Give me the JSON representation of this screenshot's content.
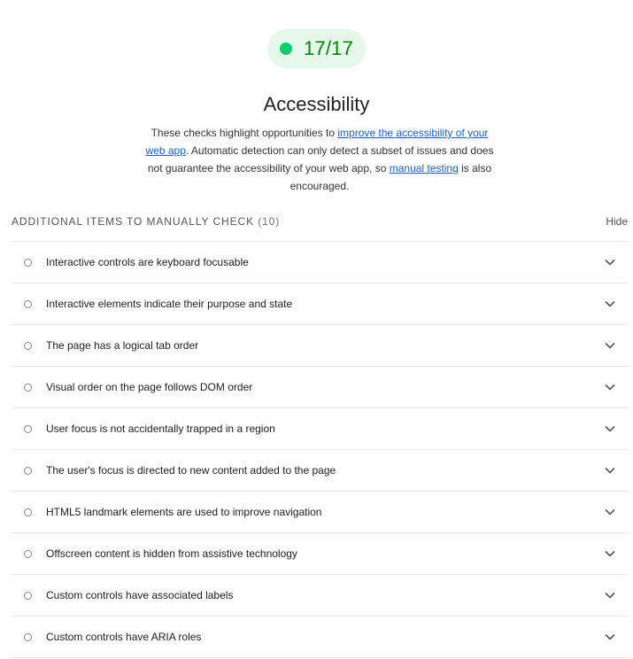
{
  "score": {
    "value": "17/17",
    "color": "#0cce6b",
    "text_color": "#008800",
    "background": "#e6f7ec"
  },
  "category": {
    "title": "Accessibility"
  },
  "description": {
    "text_1": "These checks highlight opportunities to ",
    "link_1": "improve the accessibility of your web app",
    "text_2": ". Automatic detection can only detect a subset of issues and does not guarantee the accessibility of your web app, so ",
    "link_2": "manual testing",
    "text_3": " is also encouraged."
  },
  "manual_section": {
    "title": "Additional items to manually check",
    "count": "(10)",
    "hide_label": "Hide"
  },
  "audits": [
    {
      "label": "Interactive controls are keyboard focusable"
    },
    {
      "label": "Interactive elements indicate their purpose and state"
    },
    {
      "label": "The page has a logical tab order"
    },
    {
      "label": "Visual order on the page follows DOM order"
    },
    {
      "label": "User focus is not accidentally trapped in a region"
    },
    {
      "label": "The user's focus is directed to new content added to the page"
    },
    {
      "label": "HTML5 landmark elements are used to improve navigation"
    },
    {
      "label": "Offscreen content is hidden from assistive technology"
    },
    {
      "label": "Custom controls have associated labels"
    },
    {
      "label": "Custom controls have ARIA roles"
    }
  ],
  "icons": {
    "score": "score-dot-icon",
    "audit_status": "manual-circle-icon",
    "expand": "chevron-down-icon"
  }
}
